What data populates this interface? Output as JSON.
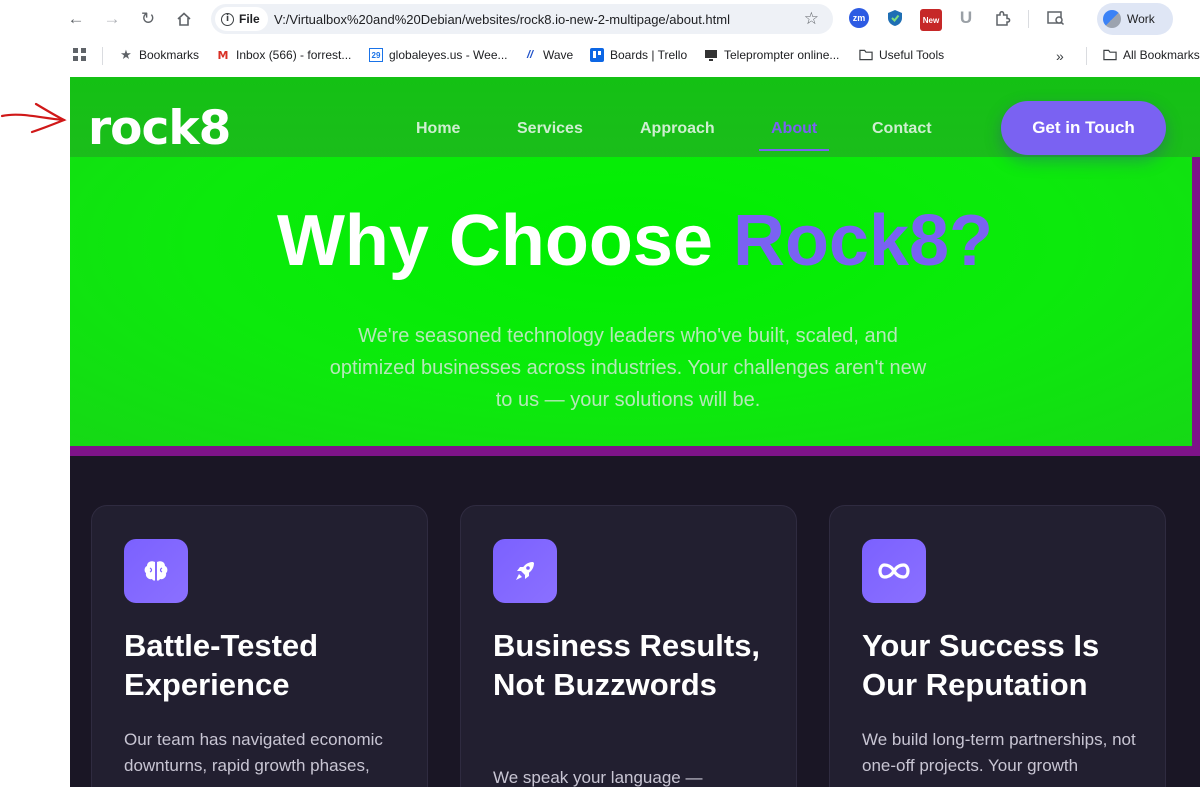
{
  "browser": {
    "site_chip": "File",
    "url": "V:/Virtualbox%20and%20Debian/websites/rock8.io-new-2-multipage/about.html",
    "profile_label": "Work",
    "ext_new_badge": "New",
    "ext_zm": "zm",
    "ext_u": "U"
  },
  "bookmarks": [
    {
      "label": "Bookmarks",
      "icon": "star-icon"
    },
    {
      "label": "Inbox (566) - forrest...",
      "icon": "gmail-icon"
    },
    {
      "label": "globaleyes.us - Wee...",
      "icon": "calendar-icon"
    },
    {
      "label": "Wave",
      "icon": "wave-icon"
    },
    {
      "label": "Boards | Trello",
      "icon": "trello-icon"
    },
    {
      "label": "Teleprompter online...",
      "icon": "monitor-icon"
    },
    {
      "label": "Useful Tools",
      "icon": "folder-icon"
    }
  ],
  "all_bookmarks": "All Bookmarks",
  "site": {
    "logo": "rock8",
    "nav": [
      "Home",
      "Services",
      "Approach",
      "About",
      "Contact"
    ],
    "active_nav": "About",
    "cta": "Get in Touch",
    "hero_title_main": "Why Choose ",
    "hero_title_accent": "Rock8?",
    "hero_subtitle": "We're seasoned technology leaders who've built, scaled, and optimized businesses across industries. Your challenges aren't new to us — your solutions will be."
  },
  "cards": [
    {
      "icon": "brain-icon",
      "title": "Battle-Tested Experience",
      "body": "Our team has navigated economic downturns, rapid growth phases,"
    },
    {
      "icon": "rocket-icon",
      "title": "Business Results, Not Buzzwords",
      "body": "We speak your language —"
    },
    {
      "icon": "infinity-icon",
      "title": "Your Success Is Our Reputation",
      "body": "We build long-term partnerships, not one-off projects. Your growth"
    }
  ],
  "colors": {
    "hero_green": "#00f000",
    "accent_purple": "#7a62f2",
    "page_dark": "#1a1625",
    "card_bg": "#221f30",
    "divider_purple": "#7e1389"
  }
}
